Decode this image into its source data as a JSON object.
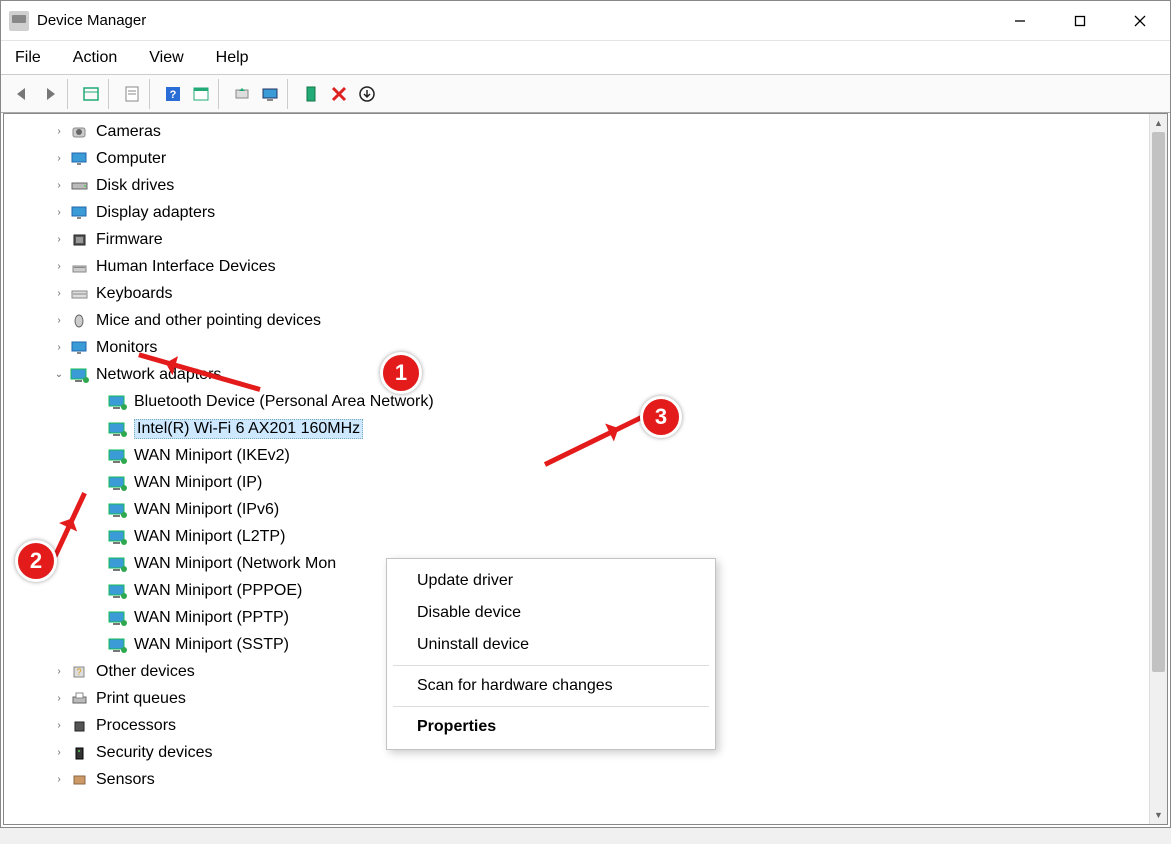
{
  "title": "Device Manager",
  "menu": {
    "items": [
      "File",
      "Action",
      "View",
      "Help"
    ]
  },
  "tree": {
    "nodes": [
      {
        "label": "Cameras",
        "icon": "camera",
        "expandable": true
      },
      {
        "label": "Computer",
        "icon": "computer",
        "expandable": true
      },
      {
        "label": "Disk drives",
        "icon": "disk",
        "expandable": true
      },
      {
        "label": "Display adapters",
        "icon": "display",
        "expandable": true
      },
      {
        "label": "Firmware",
        "icon": "firmware",
        "expandable": true
      },
      {
        "label": "Human Interface Devices",
        "icon": "hid",
        "expandable": true
      },
      {
        "label": "Keyboards",
        "icon": "keyboard",
        "expandable": true
      },
      {
        "label": "Mice and other pointing devices",
        "icon": "mouse",
        "expandable": true
      },
      {
        "label": "Monitors",
        "icon": "monitor",
        "expandable": true
      },
      {
        "label": "Network adapters",
        "icon": "network",
        "expandable": true,
        "expanded": true,
        "children": [
          {
            "label": "Bluetooth Device (Personal Area Network)"
          },
          {
            "label": "Intel(R) Wi-Fi 6 AX201 160MHz",
            "selected": true
          },
          {
            "label": "WAN Miniport (IKEv2)"
          },
          {
            "label": "WAN Miniport (IP)"
          },
          {
            "label": "WAN Miniport (IPv6)"
          },
          {
            "label": "WAN Miniport (L2TP)"
          },
          {
            "label": "WAN Miniport (Network Mon"
          },
          {
            "label": "WAN Miniport (PPPOE)"
          },
          {
            "label": "WAN Miniport (PPTP)"
          },
          {
            "label": "WAN Miniport (SSTP)"
          }
        ]
      },
      {
        "label": "Other devices",
        "icon": "other",
        "expandable": true
      },
      {
        "label": "Print queues",
        "icon": "printer",
        "expandable": true
      },
      {
        "label": "Processors",
        "icon": "cpu",
        "expandable": true
      },
      {
        "label": "Security devices",
        "icon": "security",
        "expandable": true
      },
      {
        "label": "Sensors",
        "icon": "sensor",
        "expandable": true
      }
    ]
  },
  "context_menu": {
    "items": [
      {
        "label": "Update driver"
      },
      {
        "label": "Disable device"
      },
      {
        "label": "Uninstall device"
      },
      {
        "sep": true
      },
      {
        "label": "Scan for hardware changes"
      },
      {
        "sep": true
      },
      {
        "label": "Properties",
        "bold": true
      }
    ]
  },
  "annotations": {
    "b1": "1",
    "b2": "2",
    "b3": "3"
  }
}
